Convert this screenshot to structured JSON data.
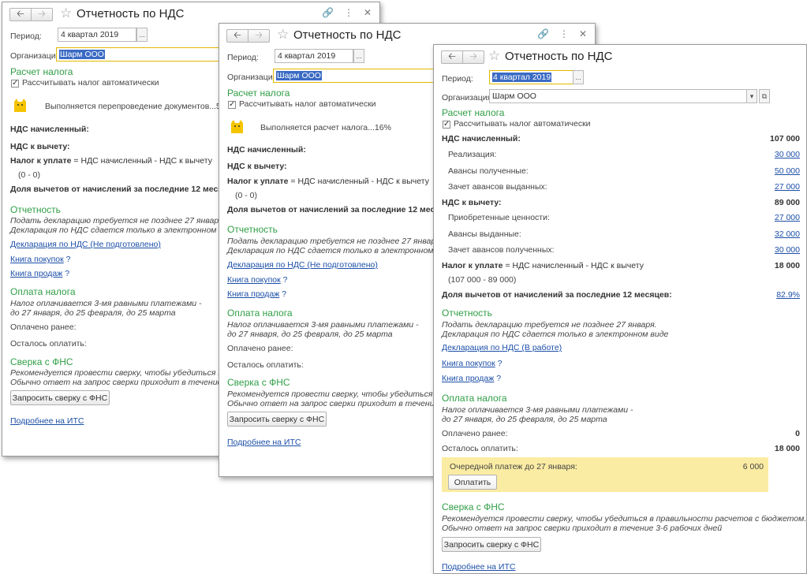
{
  "window_title": "Отчетность по НДС",
  "labels": {
    "period": "Период:",
    "organization": "Организация:",
    "section_tax_calc": "Расчет налога",
    "auto_calc": "Рассчитывать налог автоматически",
    "vat_accrued": "НДС начисленный:",
    "vat_deduct": "НДС к вычету:",
    "tax_payable_bold": "Налог к уплате",
    "tax_payable_formula": " = НДС начисленный - НДС к вычету",
    "deduction_share": "Доля вычетов от начислений за последние 12 месяцев:",
    "section_reporting": "Отчетность",
    "reporting_note1": "Подать декларацию требуется не позднее 27 января.",
    "reporting_note2": "Декларация по НДС сдается только в электронном виде",
    "purchase_book": "Книга покупок",
    "sales_book": "Книга продаж",
    "help_mark": "?",
    "section_payment": "Оплата налога",
    "payment_note1": "Налог оплачивается 3-мя равными платежами -",
    "payment_note2": "до 27 января, до 25 февраля, до 25 марта",
    "paid_earlier": "Оплачено ранее:",
    "remaining": "Осталось оплатить:",
    "section_fns": "Сверка с ФНС",
    "fns_note1": "Рекомендуется провести сверку, чтобы убедиться в правильности расчетов с бюджетом.",
    "fns_note2": "Обычно ответ на запрос сверки приходит в течение 3-6 рабочих дней",
    "request_button": "Запросить сверку с ФНС",
    "more_link": "Подробнее на ИТС"
  },
  "window1": {
    "period": "4 квартал 2019",
    "organization": "Шарм ООО",
    "progress_text": "Выполняется перепроведение документов...55%",
    "formula_values": "(0 - 0)",
    "declaration_link": "Декларация по НДС (Не подготовлено)",
    "fns_note1_visible": "Рекомендуется провести сверку, чтобы убедиться в прави",
    "fns_note2_visible": "Обычно ответ на запрос сверки приходит в течение 3-6",
    "deduction_visible": "Доля вычетов от начислений за последние 12 месяцев:"
  },
  "window2": {
    "period": "4 квартал 2019",
    "organization": "Шарм ООО",
    "progress_text": "Выполняется расчет налога...16%",
    "formula_values": "(0 - 0)",
    "declaration_link": "Декларация по НДС (Не подготовлено)",
    "fns_note1_visible": "Рекомендуется провести сверку, чтобы убедиться в праве",
    "fns_note2_visible": "Обычно ответ на запрос сверки приходит в течение 3-6 р",
    "deduction_visible": "Доля вычетов от начислений за последние 12 месяцев:"
  },
  "window3": {
    "period": "4 квартал 2019",
    "organization": "Шарм ООО",
    "vat_accrued_total": "107 000",
    "accrued_items": [
      {
        "label": "Реализация:",
        "value": "30 000"
      },
      {
        "label": "Авансы полученные:",
        "value": "50 000"
      },
      {
        "label": "Зачет авансов выданных:",
        "value": "27 000"
      }
    ],
    "vat_deduct_total": "89 000",
    "deduct_items": [
      {
        "label": "Приобретенные ценности:",
        "value": "27 000"
      },
      {
        "label": "Авансы выданные:",
        "value": "32 000"
      },
      {
        "label": "Зачет авансов полученных:",
        "value": "30 000"
      }
    ],
    "tax_payable_total": "18 000",
    "formula_values": "(107 000 - 89 000)",
    "deduction_share_value": "82.9%",
    "declaration_link": "Декларация по НДС (В работе)",
    "paid_earlier_value": "0",
    "remaining_value": "18 000",
    "next_payment_label": "Очередной платеж до 27 января:",
    "next_payment_value": "6 000",
    "pay_button": "Оплатить"
  },
  "icons": [
    "back-arrow-icon",
    "forward-arrow-icon",
    "star-icon",
    "link-icon",
    "more-icon",
    "close-icon",
    "ellipsis-icon",
    "dropdown-icon",
    "open-icon",
    "checkbox-checked-icon",
    "cat-loading-icon"
  ],
  "colors": {
    "section": "#2f9e45",
    "link": "#1c4fa8",
    "highlight": "#fbeca3",
    "active_border": "#e2b800",
    "selection": "#3b6bc4"
  }
}
